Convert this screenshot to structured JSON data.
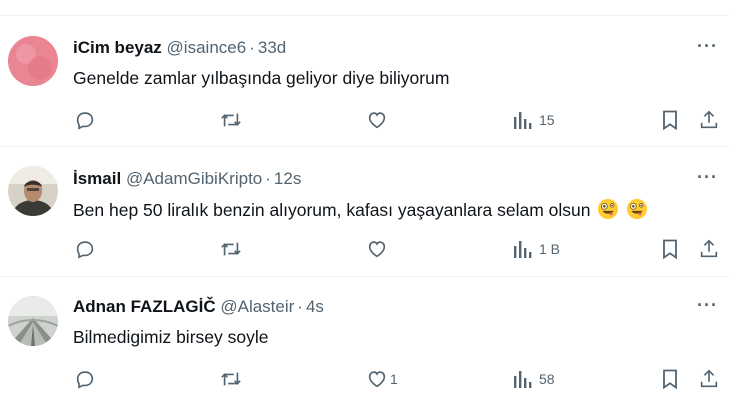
{
  "tweets": [
    {
      "name": "iCim beyaz",
      "handle": "@isaince6",
      "time": "33d",
      "text": "Genelde zamlar yılbaşında geliyor diye biliyorum",
      "replies": "",
      "retweets": "",
      "likes": "",
      "views": "15"
    },
    {
      "name": "İsmail",
      "handle": "@AdamGibiKripto",
      "time": "12s",
      "text": "Ben hep 50 liralık benzin alıyorum, kafası yaşayanlara selam olsun",
      "replies": "",
      "retweets": "",
      "likes": "",
      "views": "1 B"
    },
    {
      "name": "Adnan FAZLAGİČ",
      "handle": "@Alasteir",
      "time": "4s",
      "text": "Bilmedigimiz birsey soyle",
      "replies": "",
      "retweets": "",
      "likes": "1",
      "views": "58"
    }
  ],
  "colors": {
    "text": "#0f1419",
    "secondary": "#536471",
    "divider": "#eff3f4"
  },
  "icons": [
    "reply-icon",
    "retweet-icon",
    "like-icon",
    "views-icon",
    "bookmark-icon",
    "share-icon",
    "more-icon",
    "zany-face-emoji"
  ]
}
